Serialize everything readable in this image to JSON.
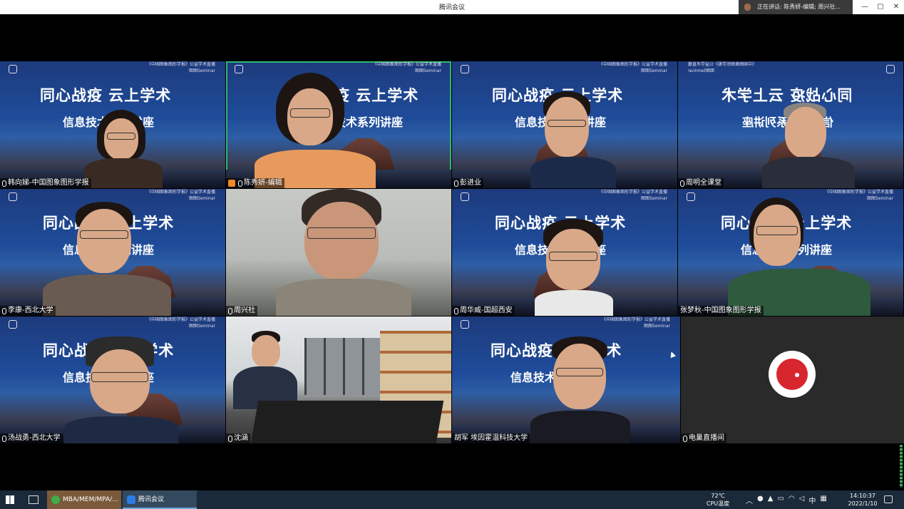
{
  "window": {
    "title": "腾讯会议",
    "speaking": "正在讲话: 陈秀妍-编辑; 周兴社...",
    "controls": [
      "—",
      "▢",
      "✕"
    ]
  },
  "banner": {
    "top": "《中国图象图形学报》公益学术直播",
    "seminar": "图图Seminar",
    "headline": "同心战疫  云上学术",
    "subline": "信息技术系列讲座"
  },
  "participants": [
    {
      "name": "韩向娣-中国图象图形学报",
      "muted": true
    },
    {
      "name": "陈秀妍-编辑",
      "muted": true,
      "host": true,
      "speaking": true
    },
    {
      "name": "彭进业",
      "muted": true
    },
    {
      "name": "周明全课堂",
      "muted": true
    },
    {
      "name": "李康-西北大学",
      "muted": true
    },
    {
      "name": "周兴社",
      "muted": true
    },
    {
      "name": "周华威-国超西安",
      "muted": true
    },
    {
      "name": "张梦秋-中国图象图形学报",
      "muted": true
    },
    {
      "name": "汤战勇-西北大学",
      "muted": true
    },
    {
      "name": "沈涵",
      "muted": true
    },
    {
      "name": "胡军 埃因霍温科技大学",
      "muted": false
    },
    {
      "name": "电巢直播间",
      "muted": true
    }
  ],
  "taskbar": {
    "apps": [
      {
        "label": "MBA/MEM/MPA/..."
      },
      {
        "label": "腾讯会议"
      }
    ],
    "temp": "72℃",
    "temp_label": "CPU温度",
    "ime": "中",
    "time": "14:10:37",
    "date": "2022/1/10"
  }
}
